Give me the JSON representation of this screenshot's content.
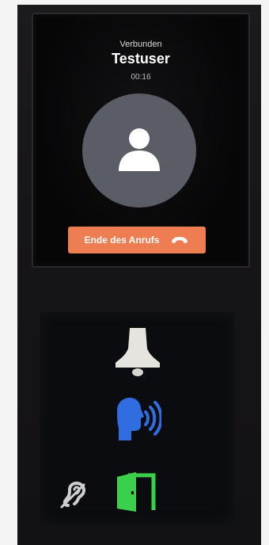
{
  "call": {
    "status": "Verbunden",
    "caller": "Testuser",
    "timer": "00:16",
    "end_button_label": "Ende des Anrufs"
  },
  "icons": {
    "avatar": "person-icon",
    "end_call": "phone-hangup-icon",
    "bell": "bell-icon",
    "speak": "speaking-person-icon",
    "door": "door-open-icon",
    "hearing": "hearing-loop-icon"
  },
  "colors": {
    "end_button": "#ef7d52",
    "speak_icon": "#2f6de0",
    "door_icon": "#3ccf4e",
    "bell_icon": "#e6e4df",
    "avatar_bg": "#5b5d66"
  }
}
